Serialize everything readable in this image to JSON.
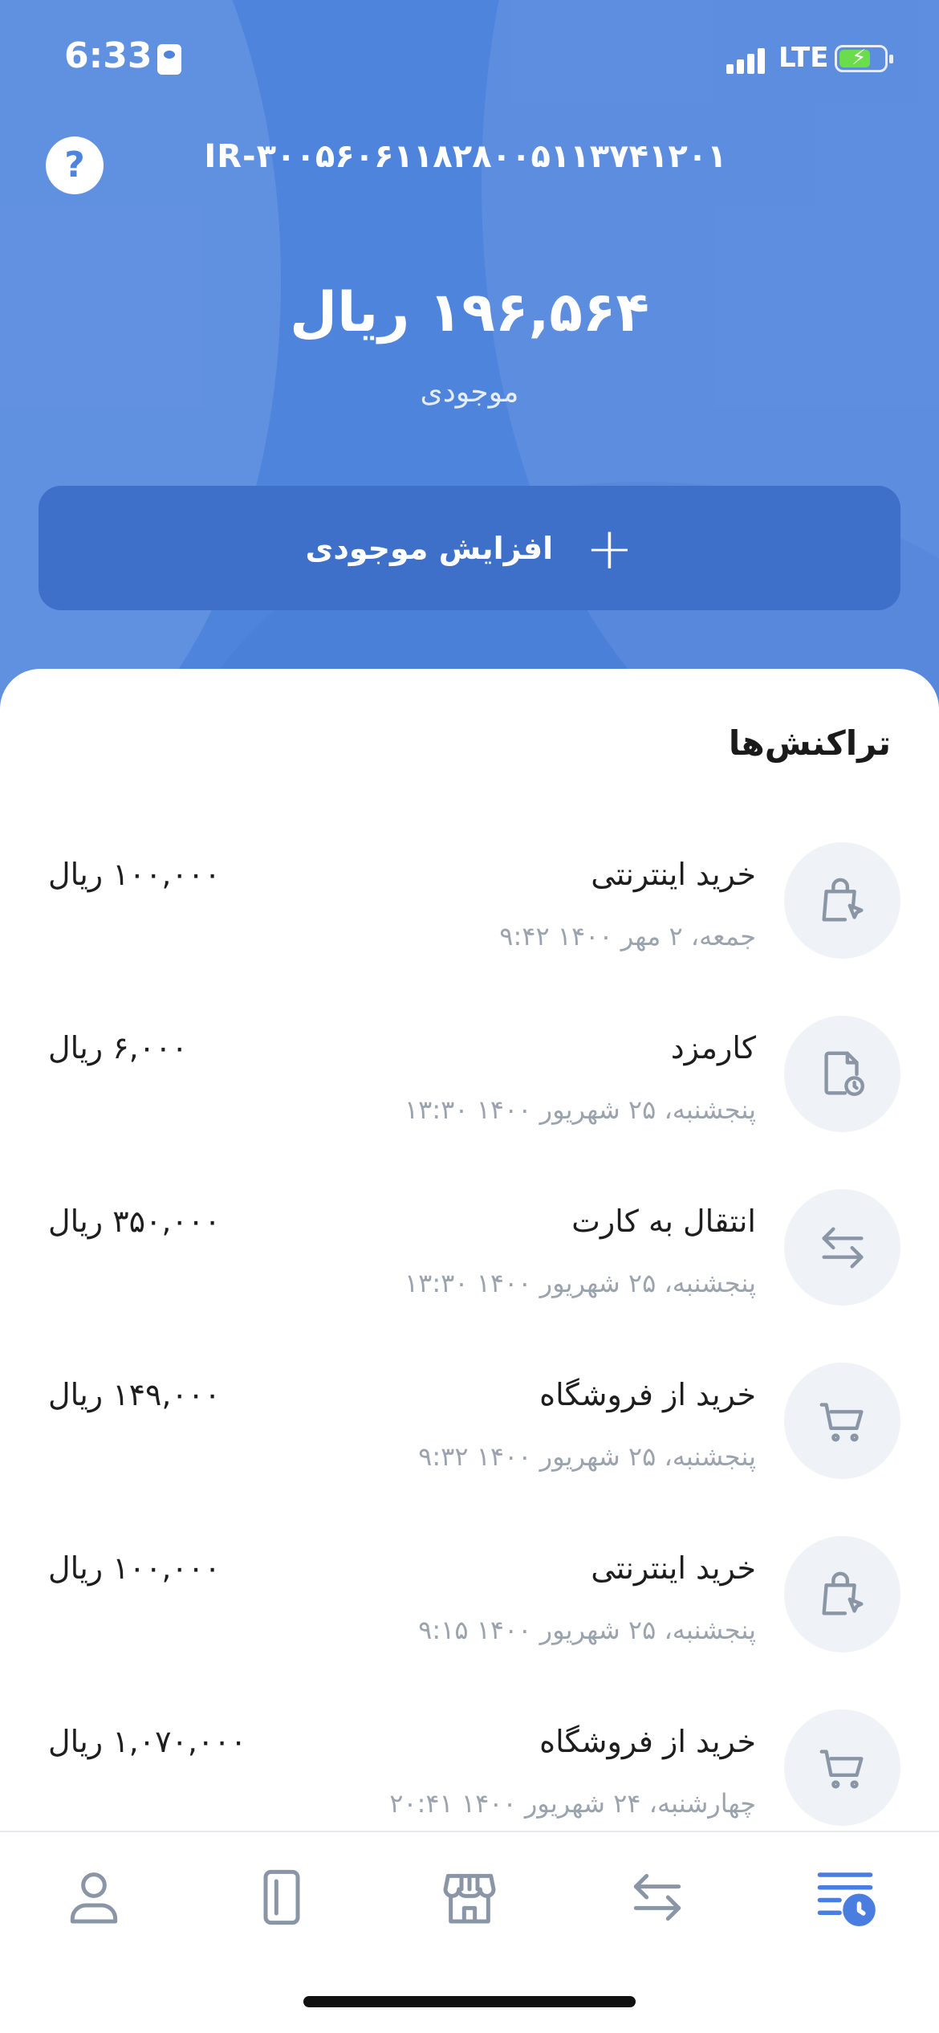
{
  "status_bar": {
    "time": "6:33",
    "network": "LTE"
  },
  "header": {
    "iban": "IR-۳۰۰۵۶۰۶۱۱۸۲۸۰۰۵۱۱۳۷۴۱۲۰۱",
    "balance": "۱۹۶,۵۶۴ ریال",
    "balance_label": "موجودی",
    "topup_label": "افزایش موجودی",
    "help_symbol": "?"
  },
  "transactions_title": "تراکنش‌ها",
  "transactions": [
    {
      "title": "خرید اینترنتی",
      "date": "جمعه، ۲ مهر ۱۴۰۰ ۹:۴۲",
      "amount": "۱۰۰,۰۰۰ ریال",
      "icon": "shopping-bag-cursor-icon"
    },
    {
      "title": "کارمزد",
      "date": "پنجشنبه، ۲۵ شهریور ۱۴۰۰ ۱۳:۳۰",
      "amount": "۶,۰۰۰ ریال",
      "icon": "document-clock-icon"
    },
    {
      "title": "انتقال به کارت",
      "date": "پنجشنبه، ۲۵ شهریور ۱۴۰۰ ۱۳:۳۰",
      "amount": "۳۵۰,۰۰۰ ریال",
      "icon": "transfer-arrows-icon"
    },
    {
      "title": "خرید از فروشگاه",
      "date": "پنجشنبه، ۲۵ شهریور ۱۴۰۰ ۹:۳۲",
      "amount": "۱۴۹,۰۰۰ ریال",
      "icon": "cart-icon"
    },
    {
      "title": "خرید اینترنتی",
      "date": "پنجشنبه، ۲۵ شهریور ۱۴۰۰ ۹:۱۵",
      "amount": "۱۰۰,۰۰۰ ریال",
      "icon": "shopping-bag-cursor-icon"
    },
    {
      "title": "خرید از فروشگاه",
      "date": "چهارشنبه، ۲۴ شهریور ۱۴۰۰ ۲۰:۴۱",
      "amount": "۱,۰۷۰,۰۰۰ ریال",
      "icon": "cart-icon"
    }
  ],
  "bottom_nav": [
    {
      "name": "profile",
      "icon": "user-icon",
      "active": false
    },
    {
      "name": "cards",
      "icon": "card-icon",
      "active": false
    },
    {
      "name": "store",
      "icon": "store-icon",
      "active": false
    },
    {
      "name": "transfer",
      "icon": "transfer-arrows-icon",
      "active": false
    },
    {
      "name": "transactions",
      "icon": "list-clock-icon",
      "active": true
    }
  ],
  "colors": {
    "hero": "#4f84dd",
    "button": "#3e70c9",
    "icon_gray": "#8a96a6",
    "active_blue": "#4a7de0"
  }
}
